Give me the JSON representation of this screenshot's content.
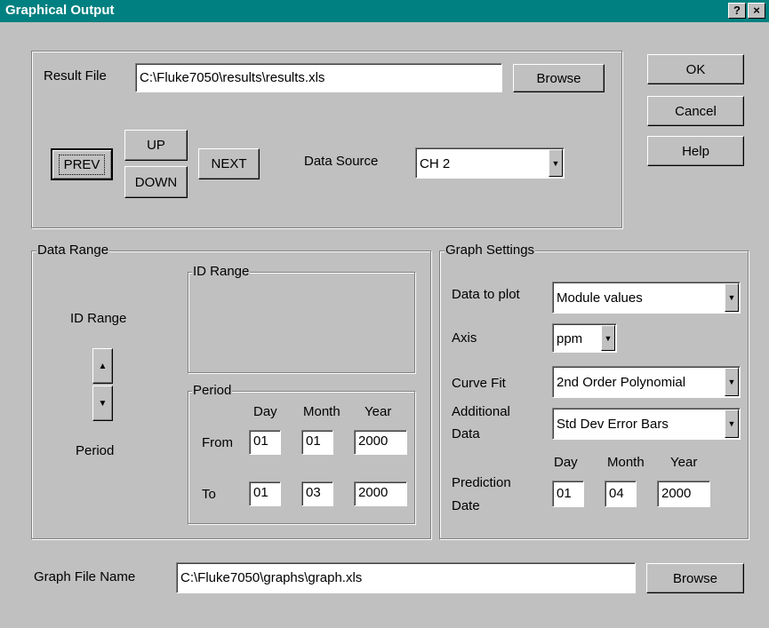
{
  "window": {
    "title": "Graphical Output",
    "help_btn": "?",
    "close_btn": "×"
  },
  "result": {
    "label": "Result File",
    "value": "C:\\Fluke7050\\results\\results.xls",
    "browse": "Browse"
  },
  "nav": {
    "prev": "PREV",
    "up": "UP",
    "down": "DOWN",
    "next": "NEXT"
  },
  "data_source": {
    "label": "Data Source",
    "value": "CH 2"
  },
  "dialog_buttons": {
    "ok": "OK",
    "cancel": "Cancel",
    "help": "Help"
  },
  "data_range": {
    "title": "Data Range",
    "id_range_label": "ID Range",
    "period_label": "Period",
    "id_range_group": "ID Range",
    "period_group": "Period",
    "col_day": "Day",
    "col_month": "Month",
    "col_year": "Year",
    "from_label": "From",
    "to_label": "To",
    "from": {
      "day": "01",
      "month": "01",
      "year": "2000"
    },
    "to": {
      "day": "01",
      "month": "03",
      "year": "2000"
    }
  },
  "graph": {
    "title": "Graph Settings",
    "data_to_plot_label": "Data to plot",
    "data_to_plot": "Module values",
    "axis_label": "Axis",
    "axis": "ppm",
    "curve_fit_label": "Curve Fit",
    "curve_fit": "2nd Order Polynomial",
    "additional_label_1": "Additional",
    "additional_label_2": "Data",
    "additional": "Std Dev Error Bars",
    "col_day": "Day",
    "col_month": "Month",
    "col_year": "Year",
    "prediction_label_1": "Prediction",
    "prediction_label_2": "Date",
    "prediction": {
      "day": "01",
      "month": "04",
      "year": "2000"
    }
  },
  "graph_file": {
    "label": "Graph File Name",
    "value": "C:\\Fluke7050\\graphs\\graph.xls",
    "browse": "Browse"
  }
}
